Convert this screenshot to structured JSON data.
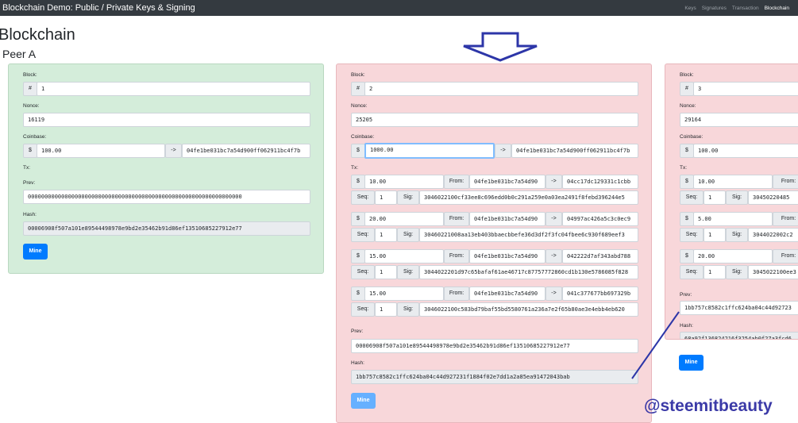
{
  "nav": {
    "brand": "Blockchain Demo: Public / Private Keys & Signing",
    "links": [
      "Keys",
      "Signatures",
      "Transaction",
      "Blockchain"
    ]
  },
  "page": {
    "title": "Blockchain",
    "peer": "Peer A"
  },
  "labels": {
    "block": "Block:",
    "nonce": "Nonce:",
    "coinbase": "Coinbase:",
    "tx": "Tx:",
    "prev": "Prev:",
    "hash": "Hash:",
    "hashsym": "#",
    "dollar": "$",
    "arrow": "->",
    "from": "From:",
    "seq": "Seq:",
    "sig": "Sig:",
    "mine": "Mine"
  },
  "blocks": [
    {
      "number": "1",
      "nonce": "16119",
      "coinbase_value": "100.00",
      "coinbase_to": "04fe1be031bc7a54d900ff062911bc4f7b",
      "prev": "0000000000000000000000000000000000000000000000000000000000000000",
      "hash": "00006908f507a101e89544498978e9bd2e35462b91d86ef13510685227912e77"
    },
    {
      "number": "2",
      "nonce": "25205",
      "coinbase_value": "1000.00",
      "coinbase_to": "04fe1be031bc7a54d900ff062911bc4f7b",
      "txs": [
        {
          "amount": "10.00",
          "from": "04fe1be031bc7a54d90",
          "to": "04cc17dc129331c1cbb",
          "seq": "1",
          "sig": "3046022100cf33ee8c696edd0b0c291a259e0a03ea2491f8febd396244e5"
        },
        {
          "amount": "20.00",
          "from": "04fe1be031bc7a54d90",
          "to": "04997ac426a5c3c0ec9",
          "seq": "1",
          "sig": "30460221008aa13eb403bbaecbbefe36d3df2f3fc04fbee6c930f689eef3"
        },
        {
          "amount": "15.00",
          "from": "04fe1be031bc7a54d90",
          "to": "042222d7af343abd788",
          "seq": "1",
          "sig": "3044022201d97c65bafaf61ae46717c87757772860cd1b130e5786085f828"
        },
        {
          "amount": "15.00",
          "from": "04fe1be031bc7a54d90",
          "to": "041c377677bb697329b",
          "seq": "1",
          "sig": "3046022100c583bd79baf55bd5580761a236a7e2f65b80ae3e4ebb4eb620"
        }
      ],
      "prev": "00006908f507a101e89544498978e9bd2e35462b91d86ef13510685227912e77",
      "hash": "1bb757c8582c1ffc624ba04c44d927231f1884f02e7dd1a2a85ea91472043bab"
    },
    {
      "number": "3",
      "nonce": "29164",
      "coinbase_value": "100.00",
      "txs": [
        {
          "amount": "10.00",
          "seq": "1",
          "sig": "30450220485"
        },
        {
          "amount": "5.00",
          "seq": "1",
          "sig": "3044022002c2"
        },
        {
          "amount": "20.00",
          "seq": "1",
          "sig": "3045022100ee3"
        }
      ],
      "prev": "1bb757c8582c1ffc624ba04c44d92723",
      "hash": "68a92f136824216f3254ab0f27a3fcd6"
    }
  ],
  "watermark": "@steemitbeauty",
  "colors": {
    "navbar": "#343a40",
    "valid_block": "#d4edda",
    "invalid_block": "#f8d7da",
    "button": "#007bff",
    "annotation": "#3b3aa7"
  }
}
